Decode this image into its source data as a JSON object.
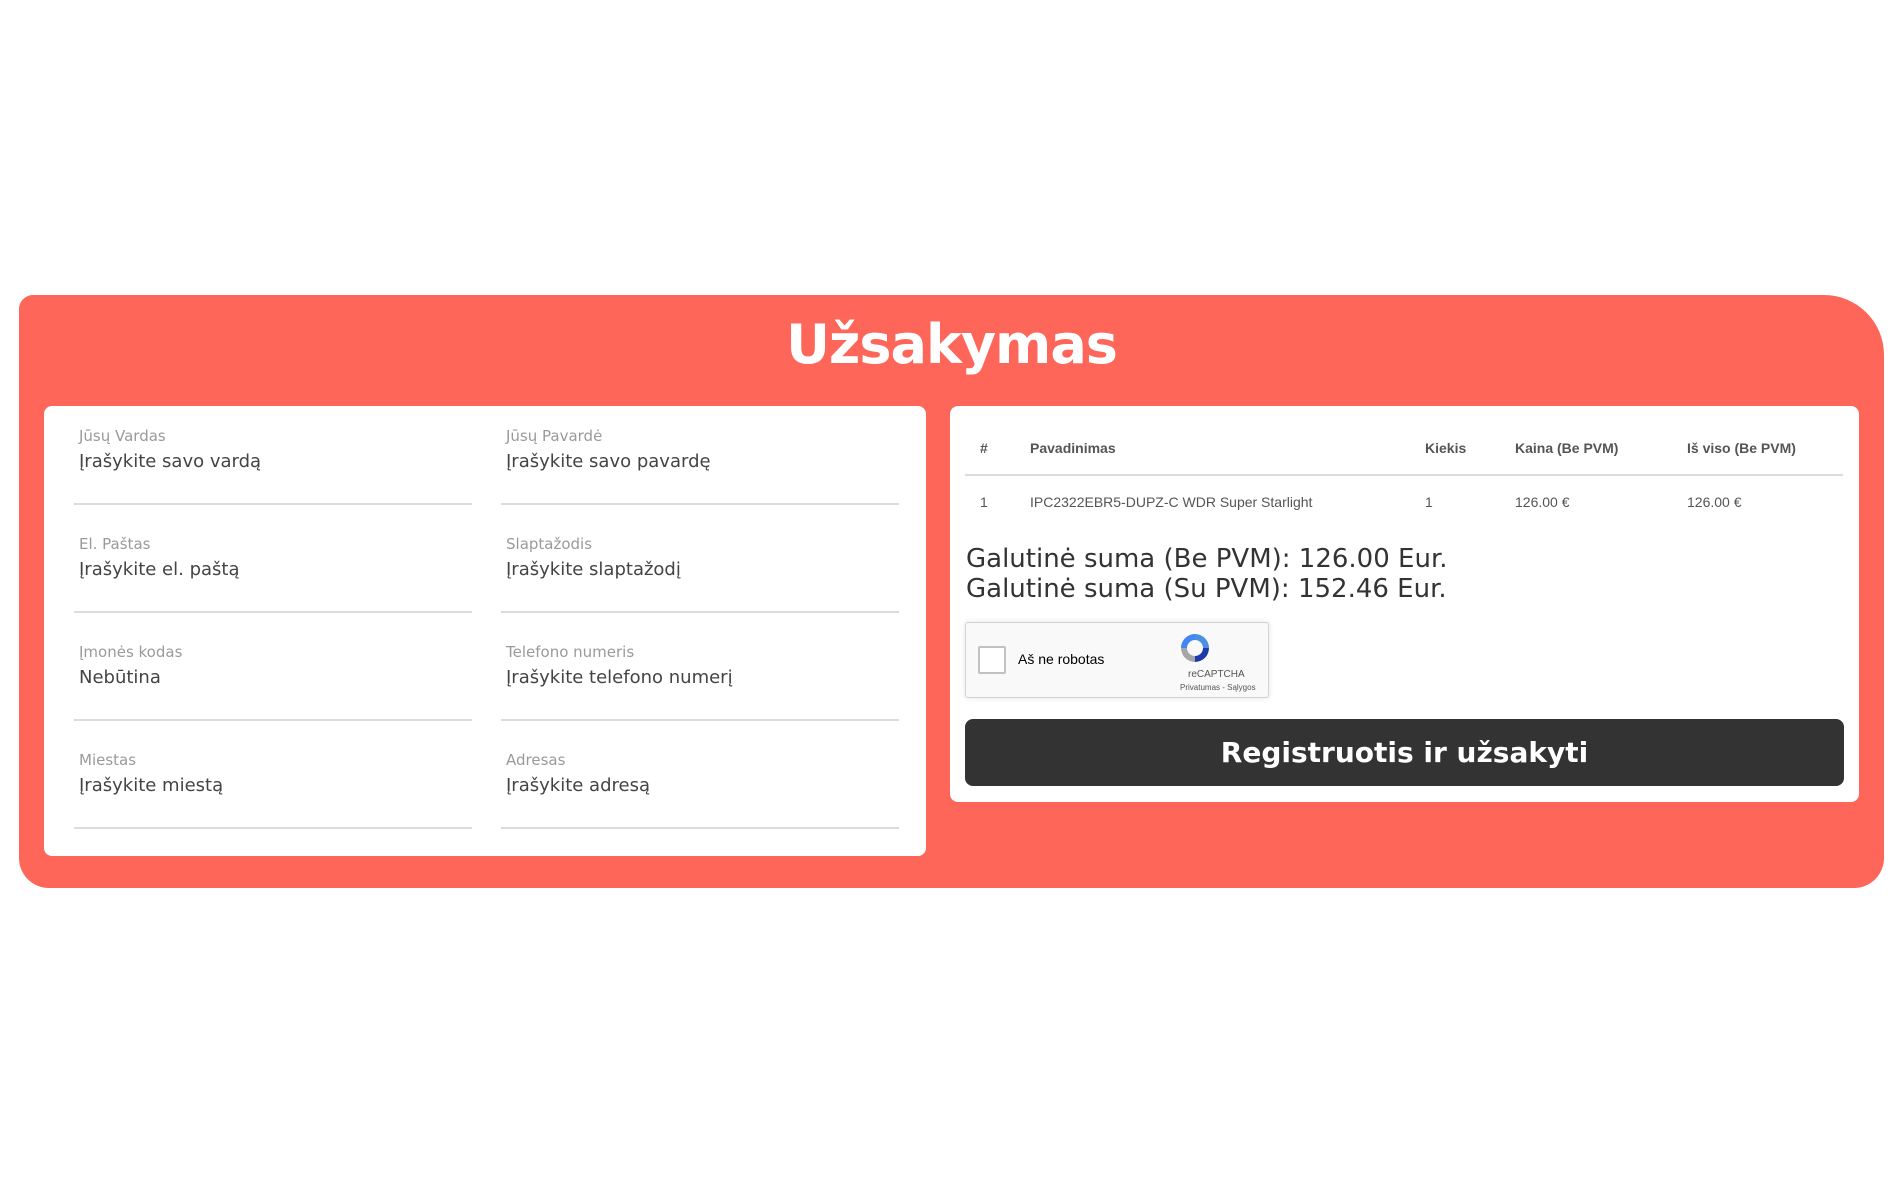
{
  "page": {
    "title": "Užsakymas"
  },
  "form": {
    "fields": [
      {
        "label": "Jūsų Vardas",
        "placeholder": "Įrašykite savo vardą"
      },
      {
        "label": "Jūsų Pavardė",
        "placeholder": "Įrašykite savo pavardę"
      },
      {
        "label": "El. Paštas",
        "placeholder": "Įrašykite el. paštą"
      },
      {
        "label": "Slaptažodis",
        "placeholder": "Įrašykite slaptažodį"
      },
      {
        "label": "Įmonės kodas",
        "placeholder": "Nebūtina"
      },
      {
        "label": "Telefono numeris",
        "placeholder": "Įrašykite telefono numerį"
      },
      {
        "label": "Miestas",
        "placeholder": "Įrašykite miestą"
      },
      {
        "label": "Adresas",
        "placeholder": "Įrašykite adresą"
      }
    ]
  },
  "cart": {
    "headers": [
      "#",
      "Pavadinimas",
      "Kiekis",
      "Kaina (Be PVM)",
      "Iš viso (Be PVM)"
    ],
    "rows": [
      [
        "1",
        "IPC2322EBR5-DUPZ-C WDR Super Starlight",
        "1",
        "126.00 €",
        "126.00 €"
      ]
    ],
    "total_without_vat": "Galutinė suma (Be PVM): 126.00 Eur.",
    "total_with_vat": "Galutinė suma (Su PVM): 152.46 Eur."
  },
  "captcha": {
    "label": "Aš ne robotas",
    "brand": "reCAPTCHA",
    "links": "Privatumas - Sąlygos",
    "icon": "recaptcha-icon"
  },
  "actions": {
    "submit_label": "Registruotis ir užsakyti"
  },
  "colors": {
    "panel": "#ff665a",
    "button": "#333333",
    "card": "#ffffff"
  }
}
